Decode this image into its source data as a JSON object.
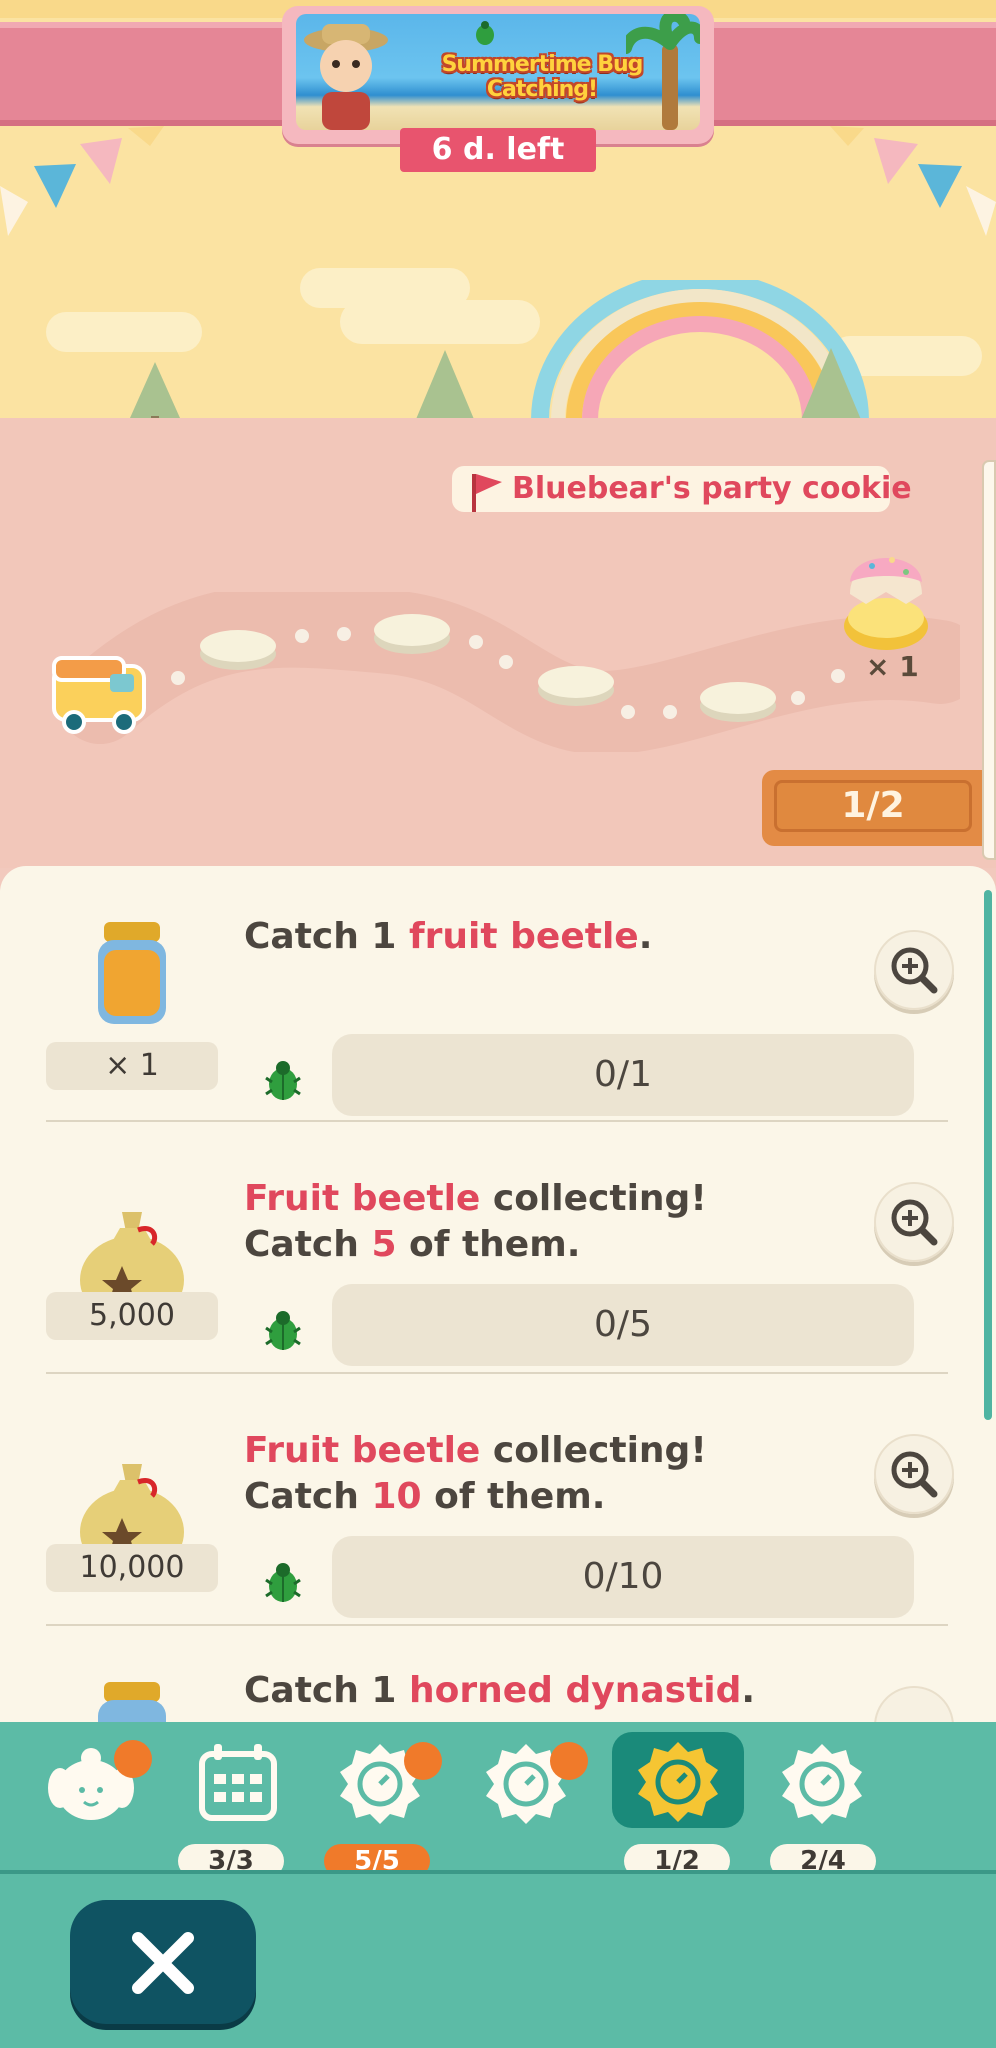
{
  "event": {
    "title": "Summertime Bug Catching!",
    "time_left": "6 d. left"
  },
  "map": {
    "reward_label": "Bluebear's party cookie",
    "reward_count": "× 1",
    "progress": "1/2",
    "progress_fraction": 0.5
  },
  "tasks": [
    {
      "reward_icon": "honey-jar-icon",
      "reward": "× 1",
      "parts": [
        {
          "text": "Catch 1 ",
          "hl": false
        },
        {
          "text": "fruit beetle",
          "hl": true
        },
        {
          "text": ".",
          "hl": false
        }
      ],
      "progress": "0/1"
    },
    {
      "reward_icon": "bell-bag-icon",
      "reward": "5,000",
      "line1": [
        {
          "text": "Fruit beetle",
          "hl": true
        },
        {
          "text": " collecting!",
          "hl": false
        }
      ],
      "line2": [
        {
          "text": "Catch ",
          "hl": false
        },
        {
          "text": "5",
          "hl": true
        },
        {
          "text": " of them.",
          "hl": false
        }
      ],
      "progress": "0/5"
    },
    {
      "reward_icon": "bell-bag-icon",
      "reward": "10,000",
      "line1": [
        {
          "text": "Fruit beetle",
          "hl": true
        },
        {
          "text": " collecting!",
          "hl": false
        }
      ],
      "line2": [
        {
          "text": "Catch ",
          "hl": false
        },
        {
          "text": "10",
          "hl": true
        },
        {
          "text": " of them.",
          "hl": false
        }
      ],
      "progress": "0/10"
    },
    {
      "reward_icon": "honey-jar-icon",
      "parts": [
        {
          "text": "Catch 1 ",
          "hl": false
        },
        {
          "text": "horned dynastid",
          "hl": true
        },
        {
          "text": ".",
          "hl": false
        }
      ]
    }
  ],
  "tabs": [
    {
      "icon": "isabelle-icon",
      "badge": "",
      "crown": true
    },
    {
      "icon": "calendar-icon",
      "badge": "3/3",
      "crown": false
    },
    {
      "icon": "event-clock-icon",
      "badge": "5/5",
      "crown": true,
      "orange": true
    },
    {
      "icon": "event-clock-icon",
      "badge": "",
      "crown": true
    },
    {
      "icon": "event-clock-icon",
      "badge": "1/2",
      "crown": false,
      "active": true
    },
    {
      "icon": "event-clock-icon",
      "badge": "2/4",
      "crown": false
    }
  ],
  "colors": {
    "accent_red": "#e0485d",
    "tab_teal": "#5cbba6",
    "close_navy": "#0f5362"
  }
}
